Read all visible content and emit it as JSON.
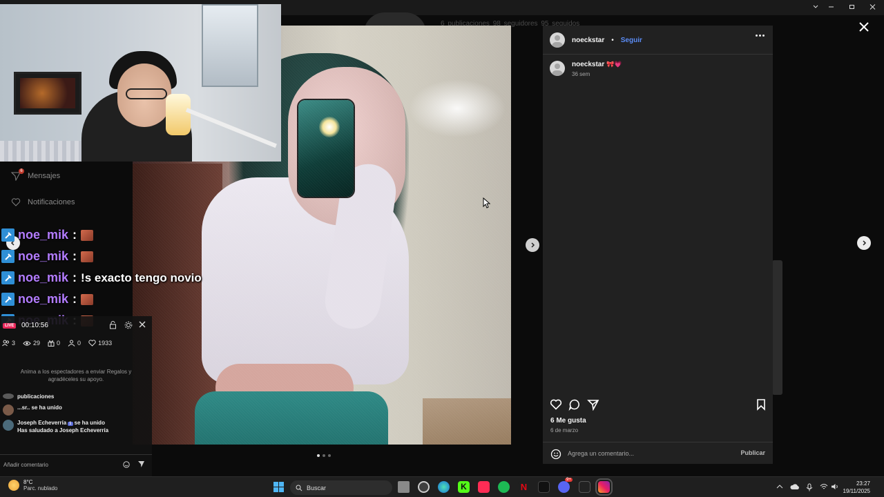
{
  "profile_stats": "6 publicaciones   98 seguidores   95 seguidos",
  "sidebar": {
    "messages_label": "Mensajes",
    "messages_badge": "6",
    "notifications_label": "Notificaciones"
  },
  "post": {
    "username": "noeckstar",
    "separator": "•",
    "follow_label": "Seguir",
    "caption_username": "noeckstar",
    "caption_emojis": "🎀💗",
    "caption_time": "36 sem",
    "likes": "6 Me gusta",
    "date": "6 de marzo",
    "comment_placeholder": "Agrega un comentario...",
    "publish_label": "Publicar",
    "carousel_total": 3,
    "carousel_active": 1
  },
  "stream_chat": [
    {
      "user": "noe_mik",
      "text": ""
    },
    {
      "user": "noe_mik",
      "text": ""
    },
    {
      "user": "noe_mik",
      "text": "!s exacto tengo novio"
    },
    {
      "user": "noe_mik",
      "text": ""
    },
    {
      "user": "noe_mik",
      "text": ""
    }
  ],
  "live_panel": {
    "live_tag": "LIVE",
    "timer": "00:10:56",
    "stats": {
      "guests": "3",
      "viewers": "29",
      "gifts": "0",
      "shares": "0",
      "likes": "1933"
    },
    "hint": "Anima a los espectadores a enviar Regalos y agradéceles su apoyo.",
    "feed": [
      {
        "text": "publicaciones"
      },
      {
        "user": "...sr..",
        "text": "se ha unido"
      },
      {
        "user": "Joseph Echeverría",
        "level": "1",
        "text": "se ha unido",
        "sub": "Has saludado a Joseph Echeverría"
      }
    ],
    "comment_placeholder": "Añadir comentario"
  },
  "taskbar": {
    "weather_temp": "8°C",
    "weather_desc": "Parc. nublado",
    "search_label": "Buscar",
    "time": "23:27",
    "date": "19/11/2025",
    "discord_badge": "9+"
  },
  "colors": {
    "instagram_blue": "#5b8cf5",
    "chat_user": "#b37cff",
    "live_red": "#e8285b"
  }
}
